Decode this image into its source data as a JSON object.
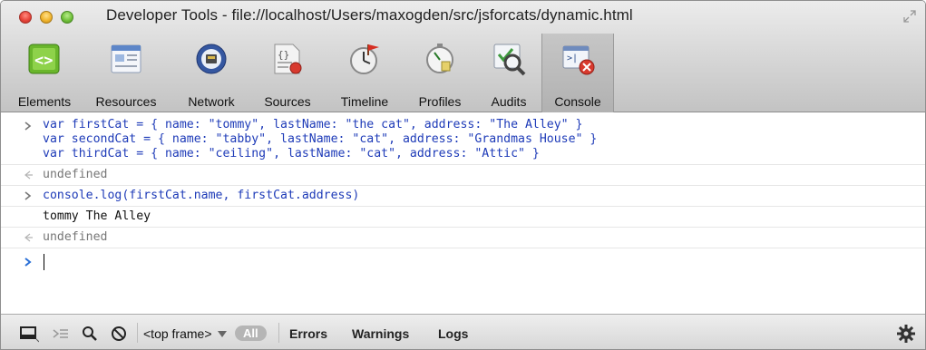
{
  "window": {
    "title": "Developer Tools - file://localhost/Users/maxogden/src/jsforcats/dynamic.html"
  },
  "toolbar": {
    "tabs": [
      {
        "label": "Elements",
        "icon": "elements-icon"
      },
      {
        "label": "Resources",
        "icon": "resources-icon"
      },
      {
        "label": "Network",
        "icon": "network-icon"
      },
      {
        "label": "Sources",
        "icon": "sources-icon"
      },
      {
        "label": "Timeline",
        "icon": "timeline-icon"
      },
      {
        "label": "Profiles",
        "icon": "profiles-icon"
      },
      {
        "label": "Audits",
        "icon": "audits-icon"
      },
      {
        "label": "Console",
        "icon": "console-icon",
        "selected": true
      }
    ]
  },
  "console": {
    "entries": [
      {
        "kind": "input",
        "lines": [
          "var firstCat = { name: \"tommy\", lastName: \"the cat\", address: \"The Alley\" }",
          "var secondCat = { name: \"tabby\", lastName: \"cat\", address: \"Grandmas House\" }",
          "var thirdCat = { name: \"ceiling\", lastName: \"cat\", address: \"Attic\" }"
        ]
      },
      {
        "kind": "result",
        "text": "undefined"
      },
      {
        "kind": "input",
        "text": "console.log(firstCat.name, firstCat.address)"
      },
      {
        "kind": "log",
        "text": "tommy The Alley"
      },
      {
        "kind": "result",
        "text": "undefined"
      }
    ],
    "prompt_value": ""
  },
  "statusbar": {
    "frame_selector": "<top frame>",
    "filters": {
      "all": "All",
      "errors": "Errors",
      "warnings": "Warnings",
      "logs": "Logs"
    }
  },
  "colors": {
    "input_text": "#1e3bb8",
    "result_text": "#777777",
    "prompt_arrow": "#2a6fd6"
  }
}
